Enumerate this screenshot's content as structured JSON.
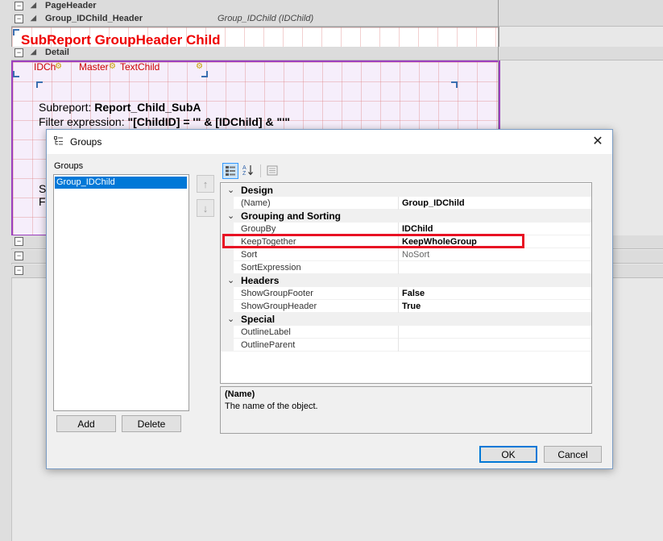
{
  "designer": {
    "bands": [
      {
        "name": "PageHeader",
        "sub": ""
      },
      {
        "name": "Group_IDChild_Header",
        "sub": "Group_IDChild (IDChild)"
      },
      {
        "name": "Detail",
        "sub": ""
      }
    ],
    "group_header_text": "SubReport GroupHeader Child",
    "detail_fields": [
      "IDCh",
      "Master",
      "TextChild"
    ],
    "subreport_label": "Subreport:",
    "subreport_name": "Report_Child_SubA",
    "filter_label": "Filter expression:",
    "filter_value": "\"[ChildID] = '\" & [IDChild] & \"'\"",
    "partial_letters": [
      "S",
      "F"
    ]
  },
  "dialog": {
    "title": "Groups",
    "close_glyph": "✕",
    "groups_label": "Groups",
    "groups": [
      "Group_IDChild"
    ],
    "add_label": "Add",
    "delete_label": "Delete",
    "move_up_glyph": "↑",
    "move_down_glyph": "↓",
    "ok_label": "OK",
    "cancel_label": "Cancel",
    "properties": {
      "categories": [
        {
          "name": "Design",
          "rows": [
            {
              "name": "(Name)",
              "value": "Group_IDChild",
              "bold": true
            }
          ]
        },
        {
          "name": "Grouping and Sorting",
          "rows": [
            {
              "name": "GroupBy",
              "value": "IDChild",
              "bold": true
            },
            {
              "name": "KeepTogether",
              "value": "KeepWholeGroup",
              "bold": true
            },
            {
              "name": "Sort",
              "value": "NoSort",
              "bold": false
            },
            {
              "name": "SortExpression",
              "value": "",
              "bold": false
            }
          ]
        },
        {
          "name": "Headers",
          "rows": [
            {
              "name": "ShowGroupFooter",
              "value": "False",
              "bold": true
            },
            {
              "name": "ShowGroupHeader",
              "value": "True",
              "bold": true
            }
          ]
        },
        {
          "name": "Special",
          "rows": [
            {
              "name": "OutlineLabel",
              "value": "",
              "bold": false
            },
            {
              "name": "OutlineParent",
              "value": "",
              "bold": false
            }
          ]
        }
      ]
    },
    "description": {
      "title": "(Name)",
      "text": "The name of the object."
    }
  },
  "colors": {
    "accent": "#0078d7",
    "highlight": "#e81123",
    "report_red": "#e00000",
    "detail_border": "#9b3fbf"
  }
}
